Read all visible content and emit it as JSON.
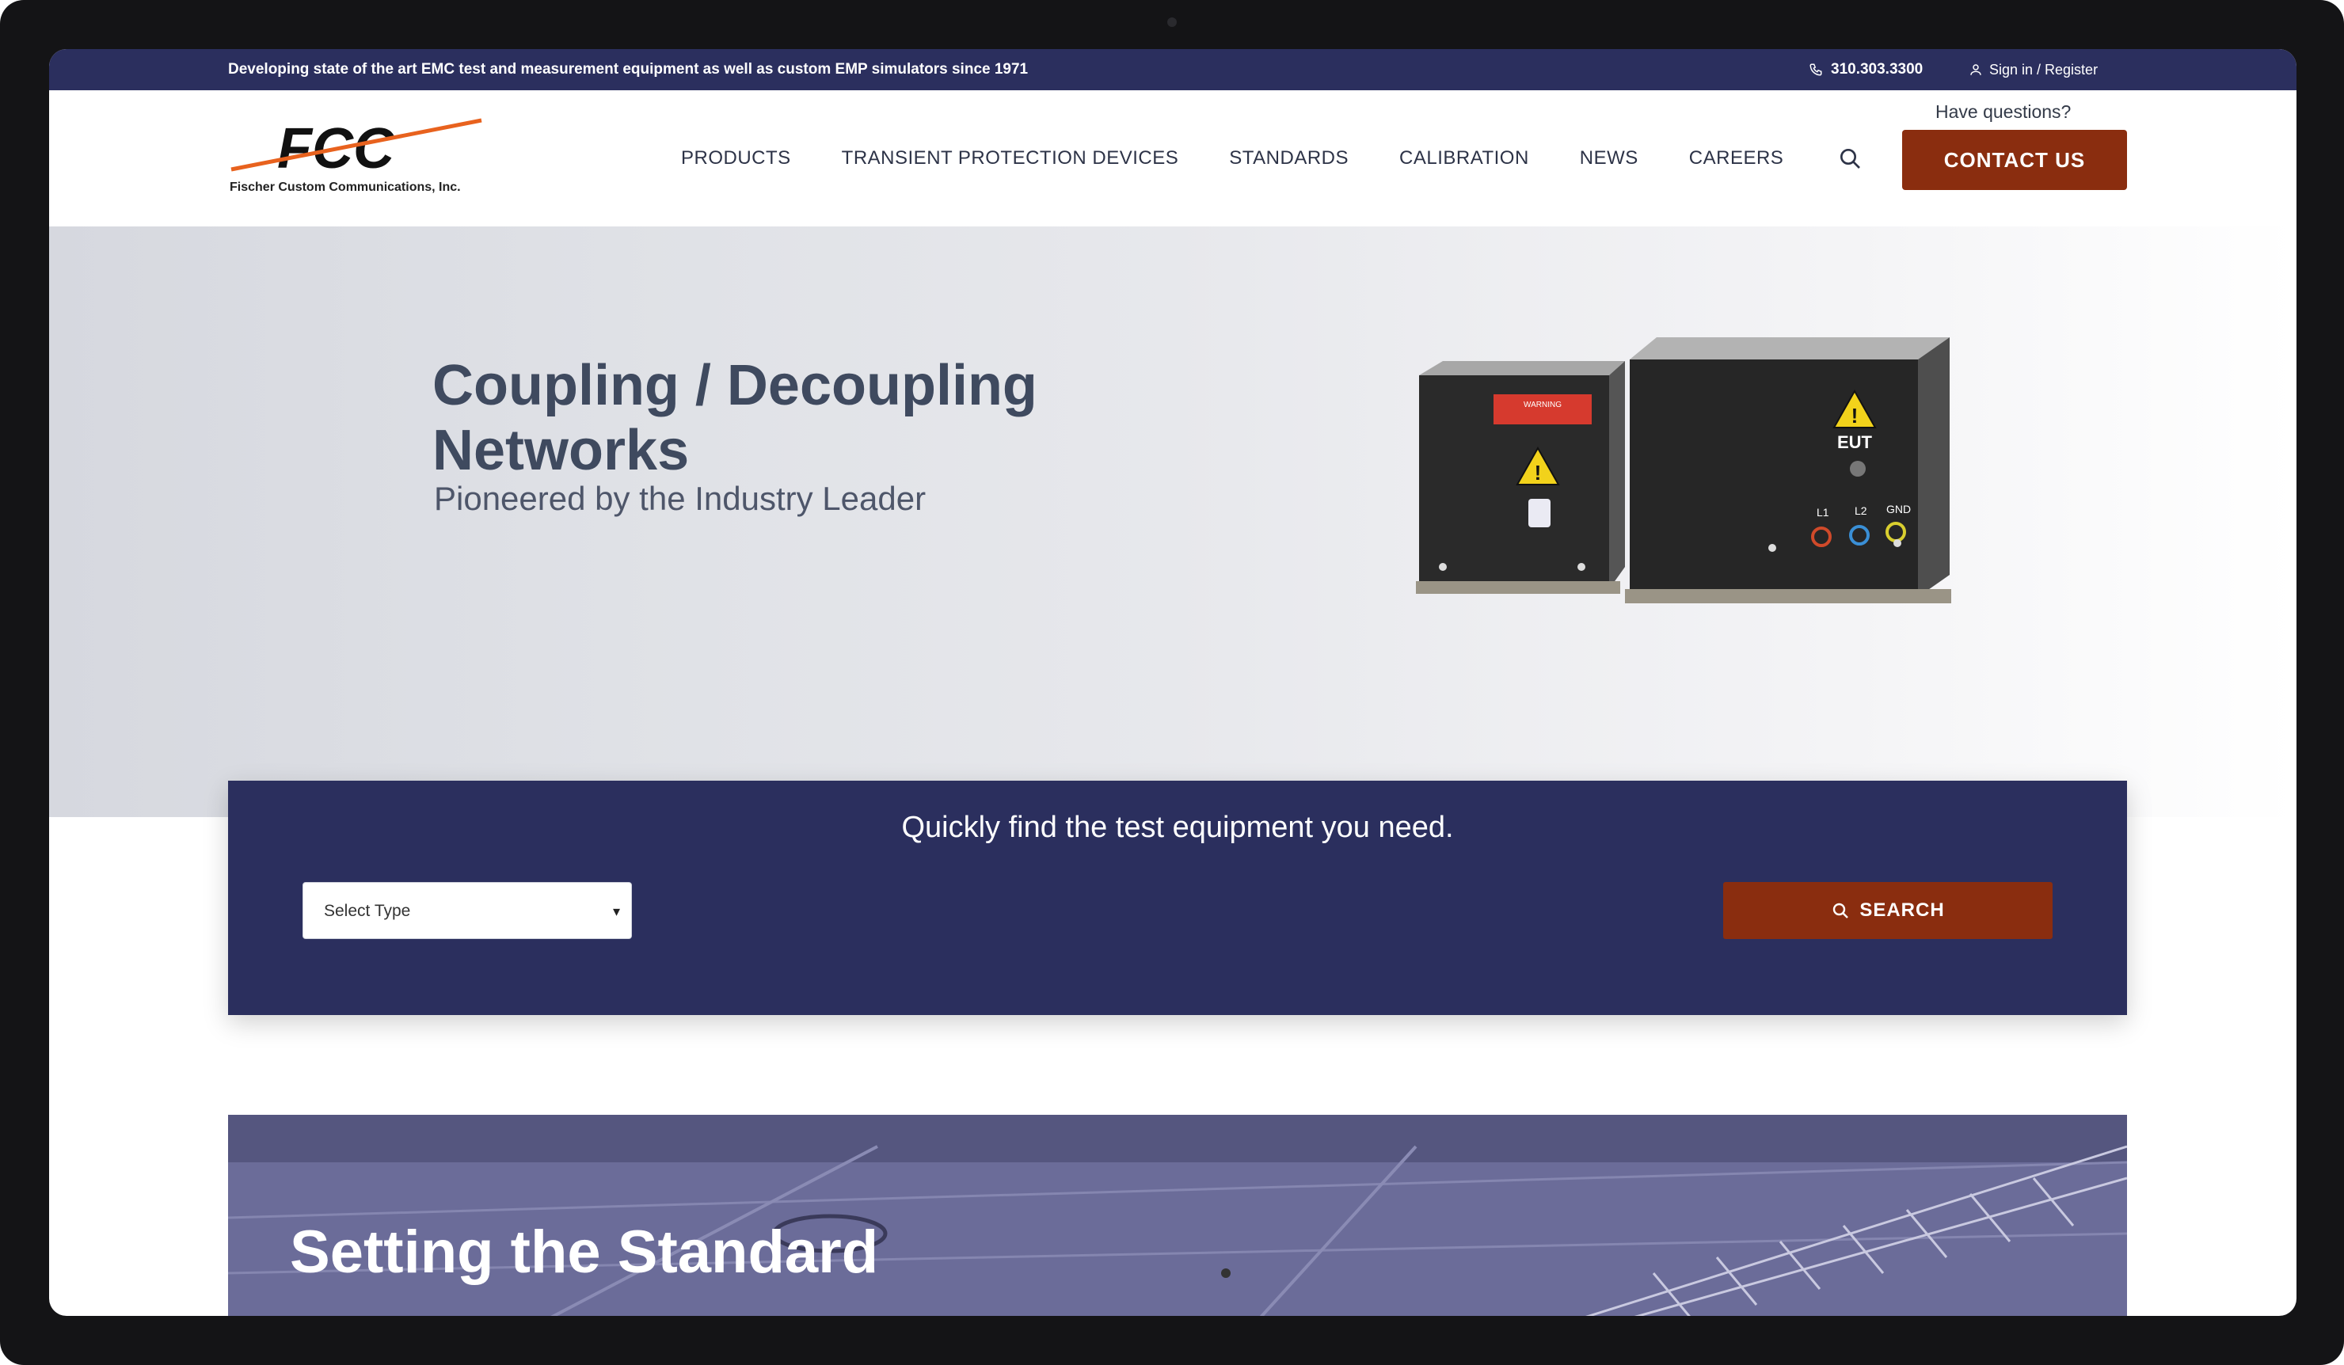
{
  "topbar": {
    "tagline": "Developing state of the art EMC test and measurement equipment as well as custom EMP simulators since 1971",
    "phone": "310.303.3300",
    "signin": "Sign in / Register"
  },
  "logo": {
    "text": "FCC",
    "subtitle": "Fischer Custom Communications, Inc."
  },
  "nav": {
    "items": [
      "PRODUCTS",
      "TRANSIENT PROTECTION DEVICES",
      "STANDARDS",
      "CALIBRATION",
      "NEWS",
      "CAREERS"
    ]
  },
  "header": {
    "have_questions": "Have questions?",
    "contact_label": "CONTACT US"
  },
  "hero": {
    "title_line1": "Coupling / Decoupling",
    "title_line2": "Networks",
    "subtitle": "Pioneered by the Industry Leader",
    "product_labels": {
      "warning": "WARNING",
      "eut": "EUT",
      "l1": "L1",
      "l2": "L2",
      "gnd": "GND"
    }
  },
  "finder": {
    "title": "Quickly find the test equipment you need.",
    "select_value": "Select Type",
    "search_label": "SEARCH"
  },
  "banner": {
    "title": "Setting the Standard"
  },
  "colors": {
    "navy": "#2b2f5e",
    "accent": "#8a2d0f",
    "logo_slash": "#e8621e"
  }
}
